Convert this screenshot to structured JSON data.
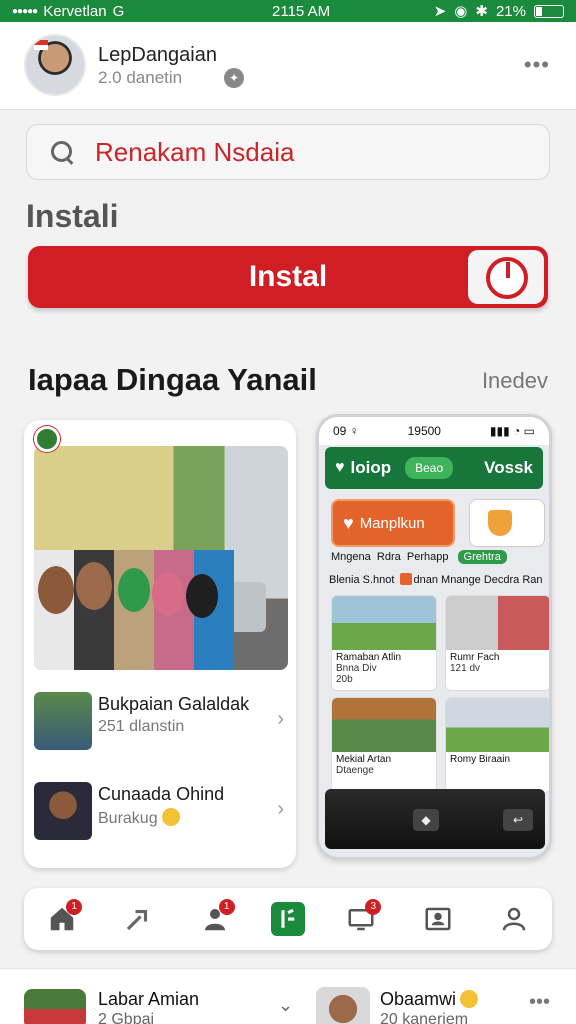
{
  "status_bar": {
    "carrier": "Kervetlan",
    "network": "G",
    "time": "2115 AM",
    "battery": "21%"
  },
  "profile": {
    "name": "LepDangaian",
    "subtitle": "2.0 danetin"
  },
  "search": {
    "placeholder": "Renakam Nsdaia"
  },
  "install_section": {
    "label": "Instali",
    "button_label": "Instal"
  },
  "section": {
    "title": "Iapaa Dingaa Yanail",
    "see_more": "Inedev"
  },
  "feed_list": [
    {
      "title": "Bukpaian Galaldak",
      "subtitle": "251 dlanstin"
    },
    {
      "title": "Cunaada Ohind",
      "subtitle": "Burakug"
    }
  ],
  "phone_preview": {
    "status_left": "09 ♀",
    "status_time": "19500",
    "nav_title": "loiop",
    "nav_chip": "Beao",
    "nav_right": "Vossk",
    "main_button": "Manplkun",
    "row1": [
      "Mngena",
      "Rdra",
      "Perhapp"
    ],
    "row1_badge": "Grehtra",
    "row2": [
      "Blenia S.hnot",
      "dnan Mnange Decdra",
      "Ran"
    ],
    "tiles": [
      {
        "title": "Ramaban Atlin",
        "subtitle": "Bnna Div",
        "meta": "20b"
      },
      {
        "title": "Rumr Fach",
        "subtitle": "",
        "meta": "121 dv"
      },
      {
        "title": "Mekial Artan",
        "subtitle": "Dtaenge",
        "meta": ""
      },
      {
        "title": "Romy Biraain",
        "subtitle": "",
        "meta": ""
      }
    ]
  },
  "bottom_nav": [
    {
      "icon": "home-icon",
      "badge": "1"
    },
    {
      "icon": "share-arrow-icon",
      "badge": ""
    },
    {
      "icon": "person-icon",
      "badge": "1"
    },
    {
      "icon": "active-tab-icon",
      "badge": ""
    },
    {
      "icon": "monitor-icon",
      "badge": "3"
    },
    {
      "icon": "id-card-icon",
      "badge": ""
    },
    {
      "icon": "profile-icon",
      "badge": ""
    }
  ],
  "bottom_strip": {
    "left_name": "Labar Amian",
    "left_sub": "2 Gbpai",
    "right_name": "Obaamwi",
    "right_sub": "20 kanerjem"
  },
  "colors": {
    "status_green": "#1a8a3c",
    "install_red": "#d01e24",
    "accent_orange": "#e3632a"
  }
}
